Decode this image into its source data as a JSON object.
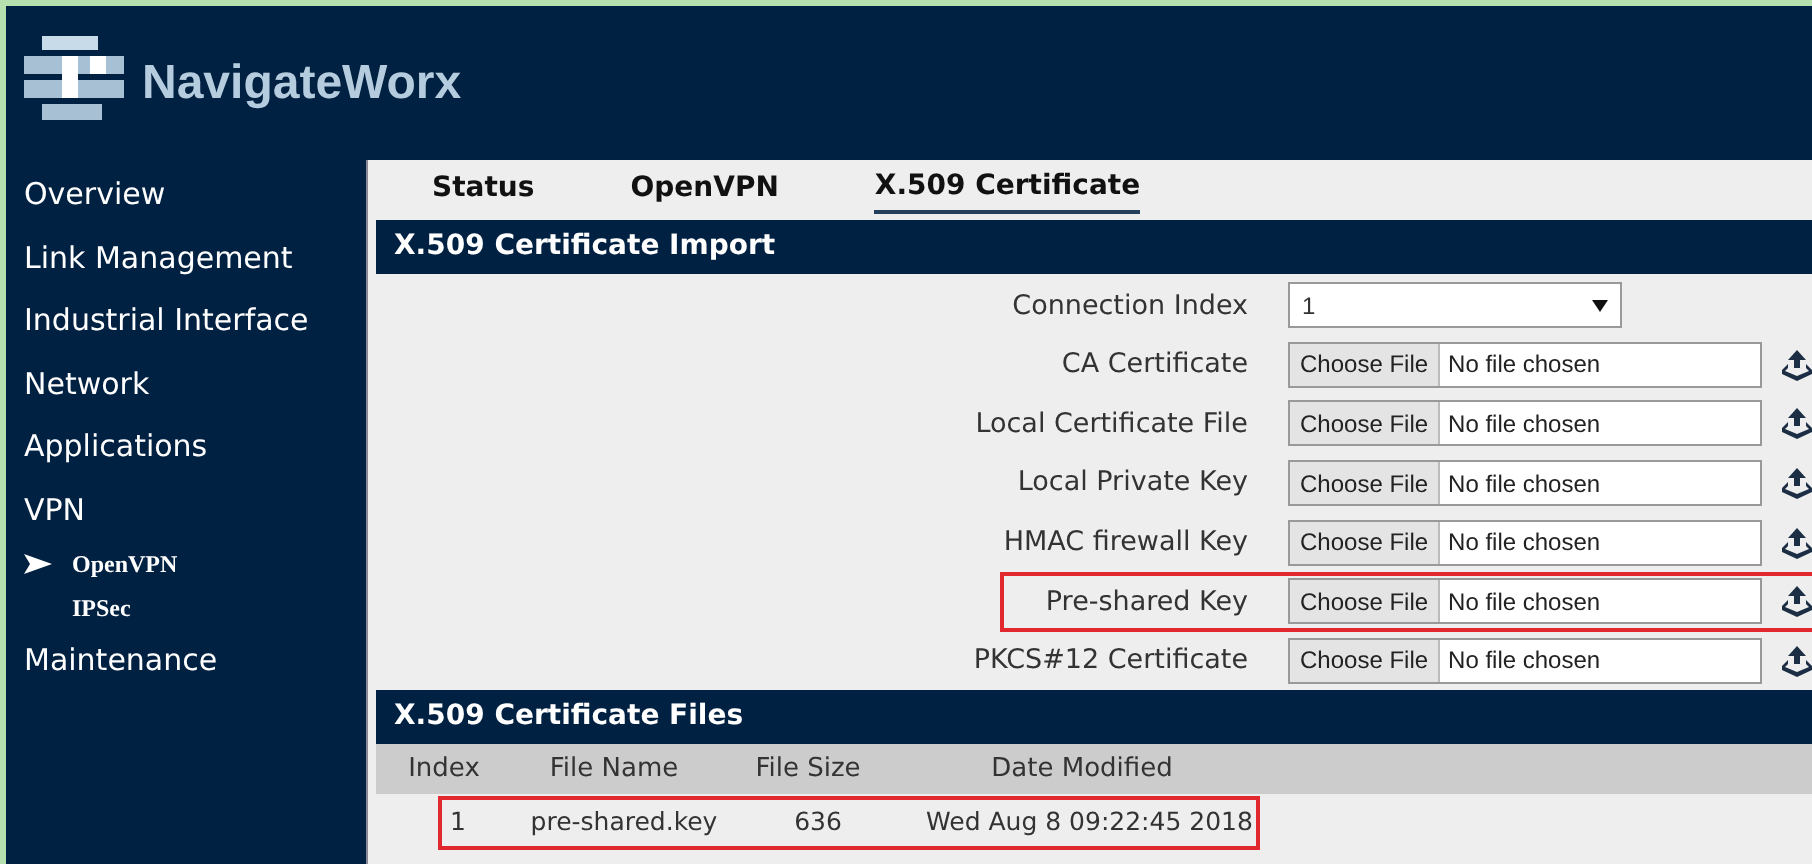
{
  "brand": "NavigateWorx",
  "sidebar": {
    "items": [
      {
        "label": "Overview",
        "selected": false
      },
      {
        "label": "Link Management",
        "selected": false
      },
      {
        "label": "Industrial Interface",
        "selected": false
      },
      {
        "label": "Network",
        "selected": false
      },
      {
        "label": "Applications",
        "selected": false
      },
      {
        "label": "VPN",
        "selected": false,
        "children": [
          {
            "label": "OpenVPN",
            "selected": true
          },
          {
            "label": "IPSec",
            "selected": false
          }
        ]
      },
      {
        "label": "Maintenance",
        "selected": false
      }
    ]
  },
  "tabs": [
    {
      "label": "Status",
      "selected": false
    },
    {
      "label": "OpenVPN",
      "selected": false
    },
    {
      "label": "X.509 Certificate",
      "selected": true
    }
  ],
  "import_section": {
    "title": "X.509 Certificate Import",
    "fields": [
      {
        "kind": "select",
        "label": "Connection Index",
        "value": "1",
        "highlighted": false
      },
      {
        "kind": "file",
        "label": "CA Certificate",
        "button": "Choose File",
        "value": "No file chosen",
        "highlighted": false
      },
      {
        "kind": "file",
        "label": "Local Certificate File",
        "button": "Choose File",
        "value": "No file chosen",
        "highlighted": false
      },
      {
        "kind": "file",
        "label": "Local Private Key",
        "button": "Choose File",
        "value": "No file chosen",
        "highlighted": false
      },
      {
        "kind": "file",
        "label": "HMAC firewall Key",
        "button": "Choose File",
        "value": "No file chosen",
        "highlighted": false
      },
      {
        "kind": "file",
        "label": "Pre-shared Key",
        "button": "Choose File",
        "value": "No file chosen",
        "highlighted": true
      },
      {
        "kind": "file",
        "label": "PKCS#12 Certificate",
        "button": "Choose File",
        "value": "No file chosen",
        "highlighted": false
      }
    ]
  },
  "files_section": {
    "title": "X.509 Certificate Files",
    "table": {
      "columns": [
        "Index",
        "File Name",
        "File Size",
        "Date Modified"
      ],
      "rows": [
        {
          "cells": [
            "1",
            "pre-shared.key",
            "636",
            "Wed Aug 8 09:22:45 2018"
          ],
          "highlighted": true
        }
      ]
    }
  }
}
